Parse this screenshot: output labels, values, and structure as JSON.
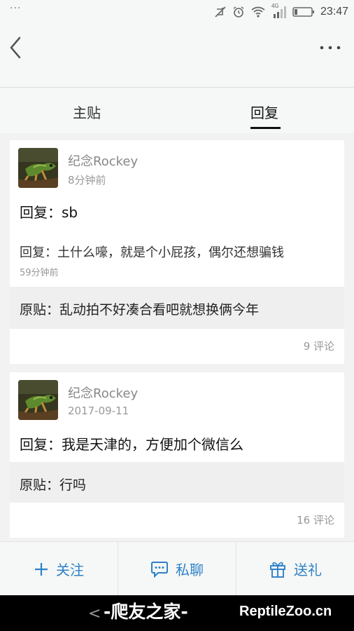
{
  "status_bar": {
    "dots": "···",
    "network": "4G",
    "time": "23:47"
  },
  "tabs": [
    {
      "label": "主贴",
      "active": false
    },
    {
      "label": "回复",
      "active": true
    }
  ],
  "posts": [
    {
      "username": "纪念Rockey",
      "time": "8分钟前",
      "reply": "回复：sb",
      "quoted_reply": "回复：土什么嚎，就是个小屁孩，偶尔还想骗钱",
      "quoted_time": "59分钟前",
      "original": "原贴：乱动拍不好凑合看吧就想换俩今年",
      "comments": "9 评论"
    },
    {
      "username": "纪念Rockey",
      "time": "2017-09-11",
      "reply": "回复：我是天津的，方便加个微信么",
      "original": "原贴：行吗",
      "comments": "16 评论"
    }
  ],
  "actions": {
    "follow": {
      "icon": "plus-icon",
      "label": "关注"
    },
    "message": {
      "icon": "chat-bubble-icon",
      "label": "私聊"
    },
    "gift": {
      "icon": "gift-icon",
      "label": "送礼"
    }
  },
  "colors": {
    "accent": "#2f80c8"
  },
  "watermark": {
    "text": "-爬友之家-",
    "url": "ReptileZoo.cn"
  }
}
